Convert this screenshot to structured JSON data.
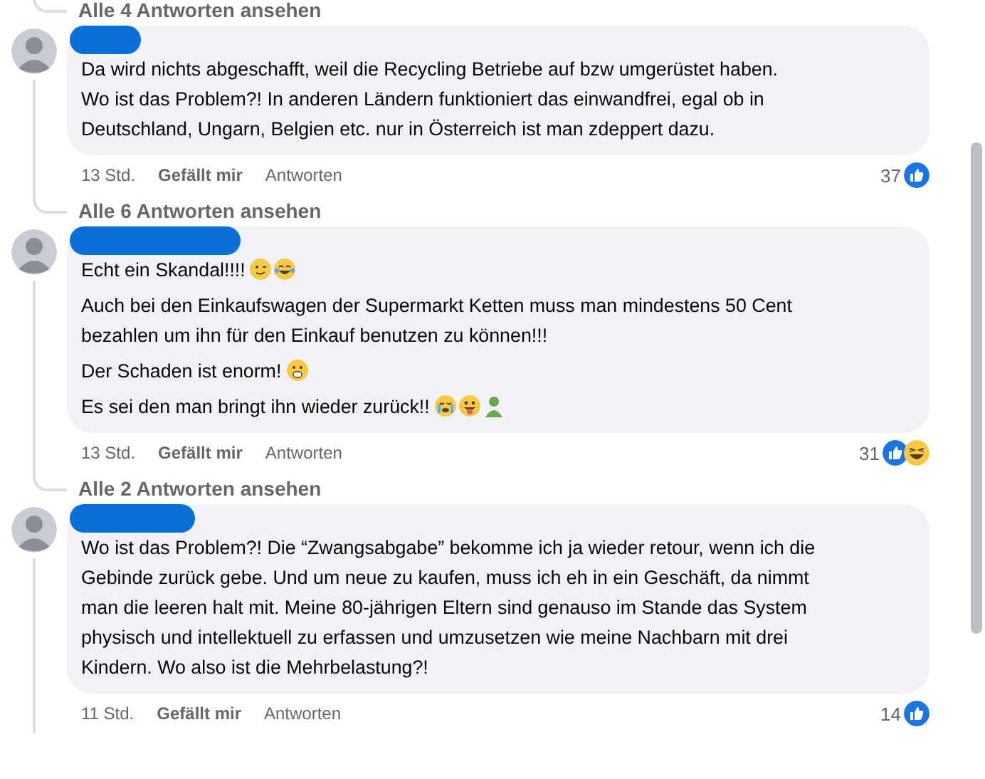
{
  "top_replies_link": "Alle 4 Antworten ansehen",
  "comments": [
    {
      "name_redacted": true,
      "paragraphs": [
        {
          "lines": [
            "Da wird nichts abgeschafft, weil die Recycling Betriebe auf bzw umgerüstet haben.",
            "Wo ist das Problem?! In anderen Ländern funktioniert das einwandfrei, egal ob in",
            "Deutschland, Ungarn, Belgien etc. nur in Österreich ist man zdeppert dazu."
          ]
        }
      ],
      "time": "13 Std.",
      "like_label": "Gefällt mir",
      "reply_label": "Antworten",
      "reaction_count": "37",
      "reactions": [
        {
          "kind": "like"
        }
      ],
      "replies_link": "Alle 6 Antworten ansehen"
    },
    {
      "name_redacted": true,
      "paragraphs": [
        {
          "lines": [
            "Echt ein Skandal!!!!"
          ],
          "emojis": [
            {
              "kind": "wink"
            },
            {
              "kind": "tears-of-joy"
            }
          ]
        },
        {
          "lines": [
            "Auch bei den Einkaufswagen der Supermarkt Ketten muss man mindestens 50 Cent",
            "bezahlen um ihn für den Einkauf benutzen zu können!!!"
          ]
        },
        {
          "lines": [
            "Der Schaden ist enorm!"
          ],
          "emojis": [
            {
              "kind": "shocked"
            }
          ]
        },
        {
          "lines": [
            "Es sei den man bringt ihn wieder zurück!!"
          ],
          "emojis": [
            {
              "kind": "crying"
            },
            {
              "kind": "tongue"
            },
            {
              "kind": "person"
            }
          ]
        }
      ],
      "time": "13 Std.",
      "like_label": "Gefällt mir",
      "reply_label": "Antworten",
      "reaction_count": "31",
      "reactions": [
        {
          "kind": "like"
        },
        {
          "kind": "haha"
        }
      ],
      "replies_link": "Alle 2 Antworten ansehen"
    },
    {
      "name_redacted": true,
      "paragraphs": [
        {
          "lines": [
            "Wo ist das Problem?! Die “Zwangsabgabe” bekomme ich ja wieder retour, wenn ich die",
            "Gebinde zurück gebe. Und um neue zu kaufen, muss ich eh in ein Geschäft, da nimmt",
            "man die leeren halt mit. Meine 80-jährigen Eltern sind genauso im Stande das System",
            "physisch und intellektuell zu erfassen und umzusetzen wie meine Nachbarn mit drei",
            "Kindern. Wo also ist die Mehrbelastung?!"
          ]
        }
      ],
      "time": "11 Std.",
      "like_label": "Gefällt mir",
      "reply_label": "Antworten",
      "reaction_count": "14",
      "reactions": [
        {
          "kind": "like"
        }
      ]
    }
  ]
}
